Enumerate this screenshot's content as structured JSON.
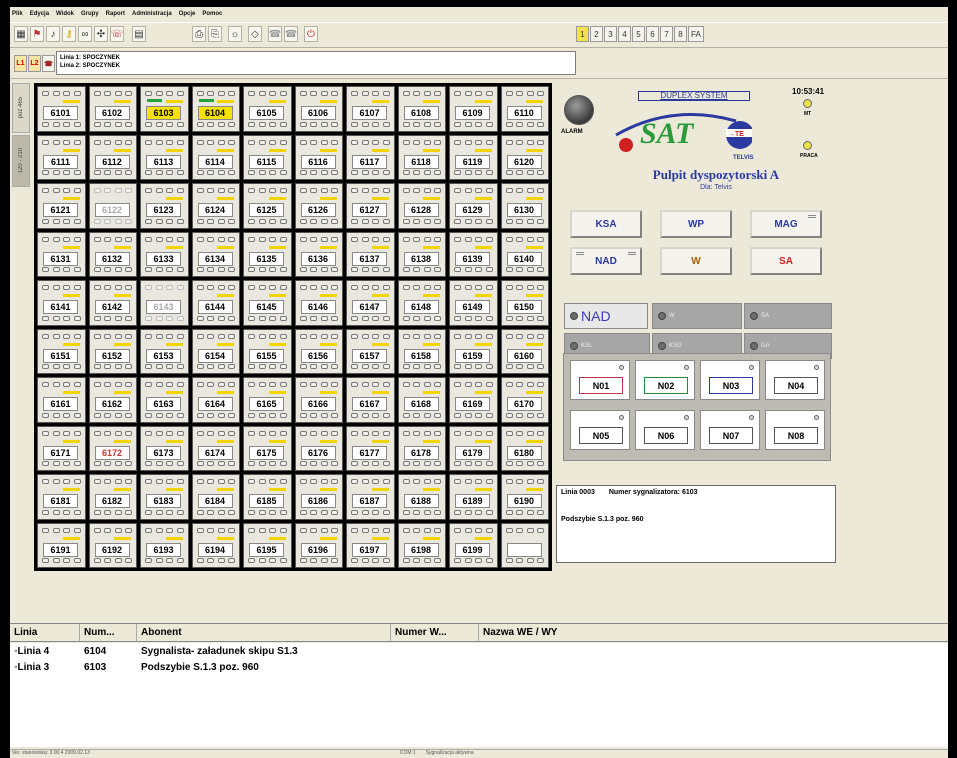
{
  "menu": [
    "Plik",
    "Edycja",
    "Widok",
    "Grupy",
    "Raport",
    "Administracja",
    "Opcje",
    "Pomoc"
  ],
  "toolbar": {
    "icons": [
      "grid-icon",
      "flag-icon",
      "speaker-icon",
      "key-icon",
      "binoculars-icon",
      "settings-icon",
      "call-icon",
      "document-icon",
      "print-icon",
      "print-preview-icon",
      "gear-icon",
      "monitor-icon",
      "phone-icon",
      "phone-group-icon",
      "power-icon"
    ],
    "pages": [
      "1",
      "2",
      "3",
      "4",
      "5",
      "6",
      "7",
      "8",
      "FA"
    ],
    "active_page": "1"
  },
  "lines": {
    "l1_label": "L1",
    "l2_label": "L2",
    "line1": "Linia 1: SPOCZYNEK",
    "line2": "Linia 2: SPOCZYNEK"
  },
  "side_tabs": [
    "poz 465",
    "120 - 210"
  ],
  "grid": {
    "numbers": [
      "6101",
      "6102",
      "6103",
      "6104",
      "6105",
      "6106",
      "6107",
      "6108",
      "6109",
      "6110",
      "6111",
      "6112",
      "6113",
      "6114",
      "6115",
      "6116",
      "6117",
      "6118",
      "6119",
      "6120",
      "6121",
      "6122",
      "6123",
      "6124",
      "6125",
      "6126",
      "6127",
      "6128",
      "6129",
      "6130",
      "6131",
      "6132",
      "6133",
      "6134",
      "6135",
      "6136",
      "6137",
      "6138",
      "6139",
      "6140",
      "6141",
      "6142",
      "6143",
      "6144",
      "6145",
      "6146",
      "6147",
      "6148",
      "6149",
      "6150",
      "6151",
      "6152",
      "6153",
      "6154",
      "6155",
      "6156",
      "6157",
      "6158",
      "6159",
      "6160",
      "6161",
      "6162",
      "6163",
      "6164",
      "6165",
      "6166",
      "6167",
      "6168",
      "6169",
      "6170",
      "6171",
      "6172",
      "6173",
      "6174",
      "6175",
      "6176",
      "6177",
      "6178",
      "6179",
      "6180",
      "6181",
      "6182",
      "6183",
      "6184",
      "6185",
      "6186",
      "6187",
      "6188",
      "6189",
      "6190",
      "6191",
      "6192",
      "6193",
      "6194",
      "6195",
      "6196",
      "6197",
      "6198",
      "6199",
      ""
    ],
    "highlighted": [
      "6103",
      "6104"
    ],
    "inactive": [
      "6122",
      "6143"
    ],
    "alert_red": [
      "6172"
    ]
  },
  "panel": {
    "alarm_label": "ALARM",
    "system_label": "DUPLEX SYSTEM",
    "clock": "10:53:41",
    "mt_label": "MT",
    "praca_label": "PRACA",
    "sat_logo": "SAT",
    "telvis_label": "TELVIS",
    "title": "Pulpit dyspozytorski A",
    "subtitle": "Dla: Telvis",
    "func_buttons": [
      {
        "label": "KSA",
        "color": "#2a3aa0"
      },
      {
        "label": "WP",
        "color": "#2a3aa0"
      },
      {
        "label": "MAG",
        "color": "#2a3aa0"
      },
      {
        "label": "NAD",
        "color": "#2a3aa0"
      },
      {
        "label": "W",
        "color": "#a06000"
      },
      {
        "label": "SA",
        "color": "#d02020"
      }
    ],
    "state_buttons": [
      "NAD",
      "W",
      "SA",
      "KSL",
      "KSG",
      "GA"
    ],
    "n_buttons": [
      {
        "label": "N01",
        "border": "#c03050"
      },
      {
        "label": "N02",
        "border": "#2a8a3a"
      },
      {
        "label": "N03",
        "border": "#2a3aa0"
      },
      {
        "label": "N04",
        "border": "#555555"
      },
      {
        "label": "N05",
        "border": "#555555"
      },
      {
        "label": "N06",
        "border": "#555555"
      },
      {
        "label": "N07",
        "border": "#555555"
      },
      {
        "label": "N08",
        "border": "#555555"
      }
    ]
  },
  "info": {
    "line": "Linia 0003",
    "signal_label": "Numer sygnalizatora:",
    "signal_value": "6103",
    "description": "Podszybie S.1.3 poz. 960"
  },
  "list": {
    "columns": [
      "Linia",
      "Num...",
      "Abonent",
      "Numer W...",
      "Nazwa WE / WY"
    ],
    "rows": [
      {
        "linia": "Linia 4",
        "num": "6104",
        "abonent": "Sygnalista- załadunek skipu S1.3"
      },
      {
        "linia": "Linia 3",
        "num": "6103",
        "abonent": "Podszybie S.1.3 poz. 960"
      }
    ]
  },
  "status": [
    "Ver. stanowiska: 3.00.4 2009.02.13",
    "COM 1",
    "Sygnalizacja aktywna"
  ]
}
